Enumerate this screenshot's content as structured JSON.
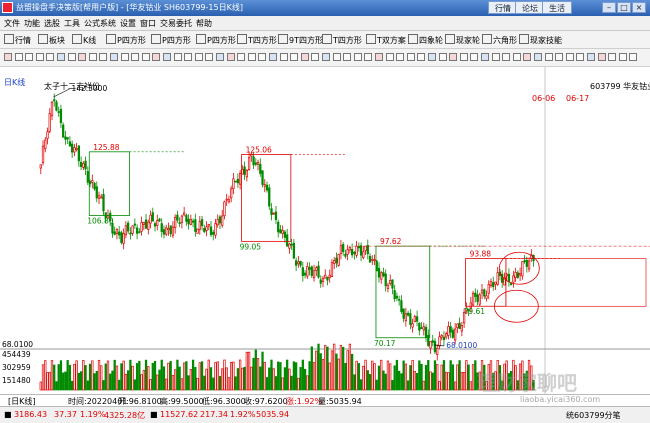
{
  "window": {
    "title": "益盟操盘手决策版[帮用户版] - [华友钴业   SH603799-15日K线]",
    "buttons": [
      "行情",
      "论坛",
      "生活"
    ]
  },
  "menu": [
    "文件",
    "功能",
    "选股",
    "工具",
    "公式系统",
    "设置",
    "窗口",
    "交易委托",
    "帮助"
  ],
  "toolbar": [
    "行情",
    "板块",
    "K线",
    "P四方形",
    "P四方形",
    "P四方形",
    "T四方形",
    "9T四方形",
    "T四方形",
    "T双方案",
    "四象轮",
    "现家轮",
    "六角形",
    "现家技能"
  ],
  "chart": {
    "period_label": "日K线",
    "stock_label": "603799 华友钴业",
    "peak_label": "太子十二吉祥份",
    "date_labels": [
      "06-06",
      "06-17"
    ],
    "price_labels": {
      "high": "142.3000",
      "box1_top": "125.88",
      "box1_bottom": "106.80",
      "box2_top": "125.06",
      "box2_bottom": "99.05",
      "box3_top": "97.62",
      "box3_bottom": "70.17",
      "box4_top": "93.88",
      "box4_bottom": "79.61",
      "low": "68.0100",
      "axis_low": "68.0100"
    },
    "volume_axis": [
      "454439",
      "302959",
      "151480"
    ]
  },
  "chart_data": {
    "type": "candlestick",
    "title": "华友钴业 SH603799 日K线",
    "ylim": [
      68,
      142.3
    ],
    "annotated_high": 142.3,
    "annotated_low": 68.01,
    "boxes": [
      {
        "top": 125.88,
        "bottom": 106.8
      },
      {
        "top": 125.06,
        "bottom": 99.05
      },
      {
        "top": 97.62,
        "bottom": 70.17
      },
      {
        "top": 93.88,
        "bottom": 79.61
      }
    ],
    "volume_ticks": [
      454439,
      302959,
      151480
    ]
  },
  "status": {
    "quote_prefix": "[日K线]",
    "open": "开:96.8100",
    "high": "高:99.5000",
    "low": "低:96.3000",
    "close": "收:97.6200",
    "change": "涨:1.92%",
    "volume": "量:5035.94",
    "date_text": "时间:20220401"
  },
  "infobar": {
    "sh_index": "3186.43",
    "sh_change": "37.37",
    "sh_pct": "1.19%",
    "sh_amount": "4325.28亿",
    "sz_index": "11527.62",
    "sz_change": "217.34",
    "sz_pct": "1.92%",
    "sz_amount": "5035.94",
    "notice": "统603799分笔"
  },
  "watermark": "理财家聊吧",
  "watermark_sub": "liaoba.yicai360.com"
}
